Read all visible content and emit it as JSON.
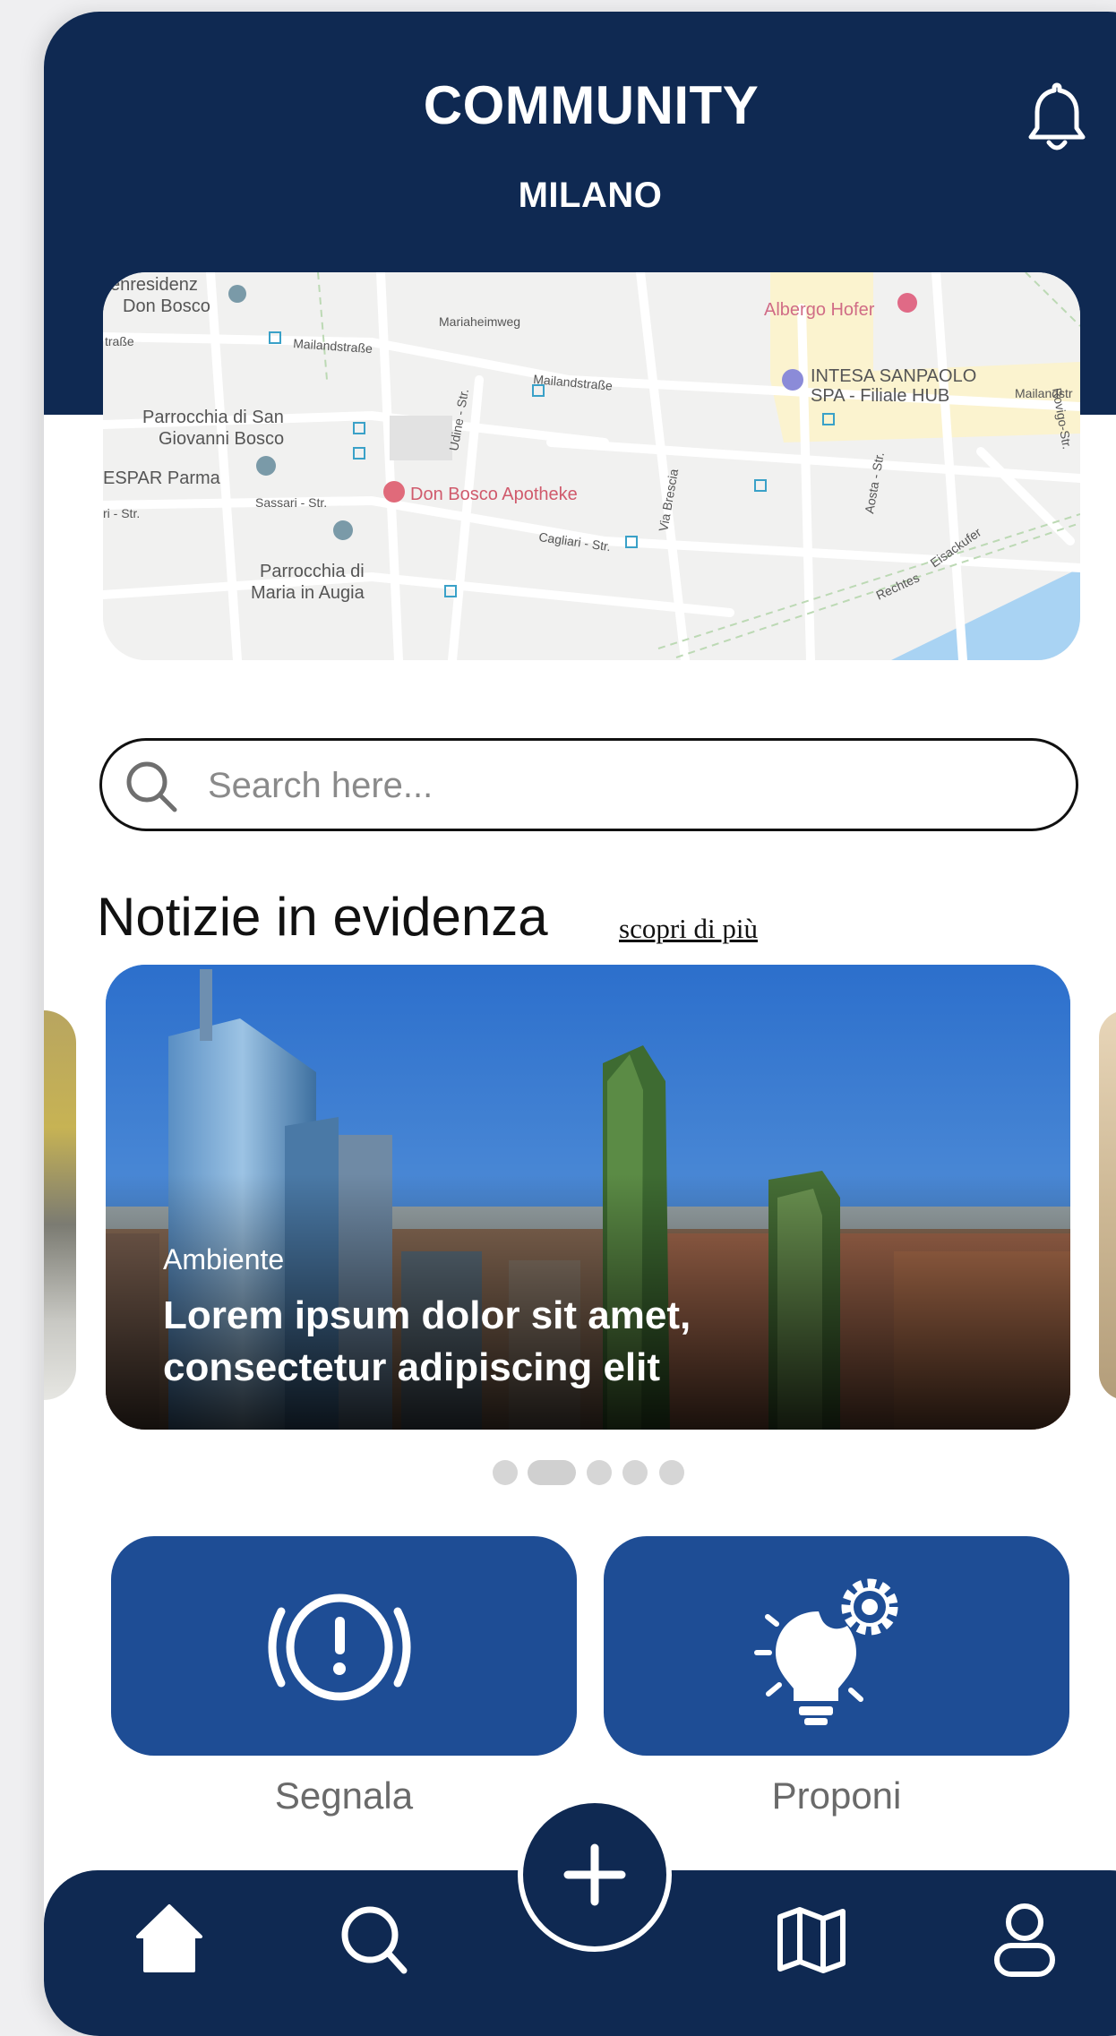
{
  "header": {
    "title": "COMMUNITY",
    "city": "MILANO",
    "bell_icon": "bell-icon"
  },
  "map": {
    "labels": {
      "residenza": "enresidenz",
      "don_bosco_top": "Don Bosco",
      "strasse_left": "traße",
      "mailand1": "Mailandstraße",
      "mariaheim": "Mariaheimweg",
      "albergo": "Albergo Hofer",
      "mailand2": "Mailandstraße",
      "intesa1": "INTESA SANPAOLO",
      "intesa2": "SPA - Filiale HUB",
      "mailand3": "Mailandstr",
      "parr1a": "Parrocchia di San",
      "parr1b": "Giovanni Bosco",
      "despar": "ESPAR Parma",
      "udine": "Udine - Str.",
      "apotheke": "Don Bosco Apotheke",
      "sassari": "Sassari - Str.",
      "str_left": "ri - Str.",
      "brescia": "Via Brescia",
      "aosta": "Aosta - Str.",
      "rovigo": "Rovigo-Str.",
      "cagliari": "Cagliari - Str.",
      "parr2a": "Parrocchia di",
      "parr2b": "Maria in Augia",
      "eisackufer": "Eisackufer",
      "rechtes": "Rechtes"
    }
  },
  "search": {
    "placeholder": "Search here..."
  },
  "news": {
    "section_title": "Notizie in evidenza",
    "more_link": "scopri di più",
    "card": {
      "tag": "Ambiente",
      "title": "Lorem ipsum dolor sit amet, consectetur adipiscing elit"
    },
    "carousel": {
      "count": 5,
      "active_index": 1
    }
  },
  "actions": [
    {
      "label": "Segnala",
      "icon": "alert-icon"
    },
    {
      "label": "Proponi",
      "icon": "lightbulb-gear-icon"
    }
  ],
  "nav": {
    "items": [
      "home-icon",
      "search-icon",
      "add-icon",
      "map-icon",
      "profile-icon"
    ],
    "active": "home-icon"
  },
  "colors": {
    "primary_dark": "#0f2952",
    "action_blue": "#1e4d95"
  }
}
